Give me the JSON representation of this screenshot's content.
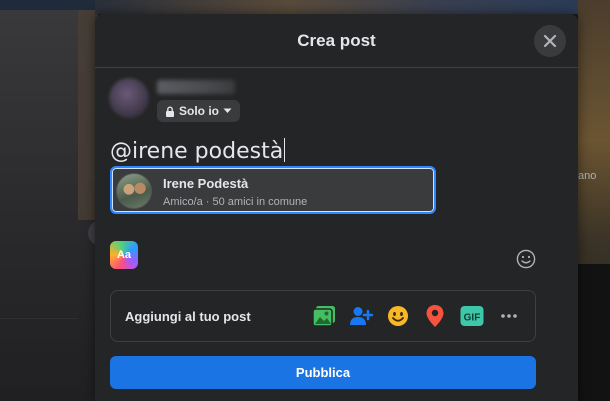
{
  "modal": {
    "title": "Crea post"
  },
  "user": {
    "audience": "Solo io"
  },
  "composer": {
    "text": "@irene podestà"
  },
  "mention_suggestion": {
    "name": "Irene Podestà",
    "subtitle": "Amico/a · 50 amici in comune"
  },
  "font_button": {
    "label": "Aa"
  },
  "add_to_post": {
    "label": "Aggiungi al tuo post",
    "icons": [
      "photo-video-icon",
      "tag-people-icon",
      "feeling-icon",
      "check-in-icon",
      "gif-icon",
      "more-icon"
    ]
  },
  "publish": {
    "label": "Pubblica"
  },
  "background": {
    "right_text": "ano"
  },
  "colors": {
    "accent": "#1b74e4",
    "modal_bg": "#242526",
    "photo_green": "#45bd62",
    "tag_blue": "#1877f2",
    "feeling_yellow": "#f7b928",
    "checkin_red": "#f5533d",
    "gif_teal": "#3ec6a8"
  }
}
